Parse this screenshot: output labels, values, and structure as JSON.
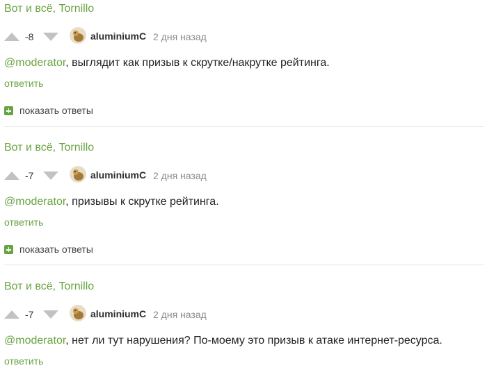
{
  "comments": [
    {
      "title": "Вот и всё, Tornillo",
      "score": "-8",
      "author": "aluminiumC",
      "time": "2 дня назад",
      "mention": "@moderator",
      "text": ", выглядит как призыв к скрутке/накрутке рейтинга.",
      "reply_label": "ответить",
      "show_replies_label": "показать ответы"
    },
    {
      "title": "Вот и всё, Tornillo",
      "score": "-7",
      "author": "aluminiumC",
      "time": "2 дня назад",
      "mention": "@moderator",
      "text": ", призывы к скрутке рейтинга.",
      "reply_label": "ответить",
      "show_replies_label": "показать ответы"
    },
    {
      "title": "Вот и всё, Tornillo",
      "score": "-7",
      "author": "aluminiumC",
      "time": "2 дня назад",
      "mention": "@moderator",
      "text": ", нет ли тут нарушения? По-моему это призыв к атаке интернет-ресурса.",
      "reply_label": "ответить"
    }
  ],
  "colors": {
    "accent": "#6aa342",
    "vote_arrow": "#c2c2c2",
    "muted": "#8a8a8a"
  }
}
